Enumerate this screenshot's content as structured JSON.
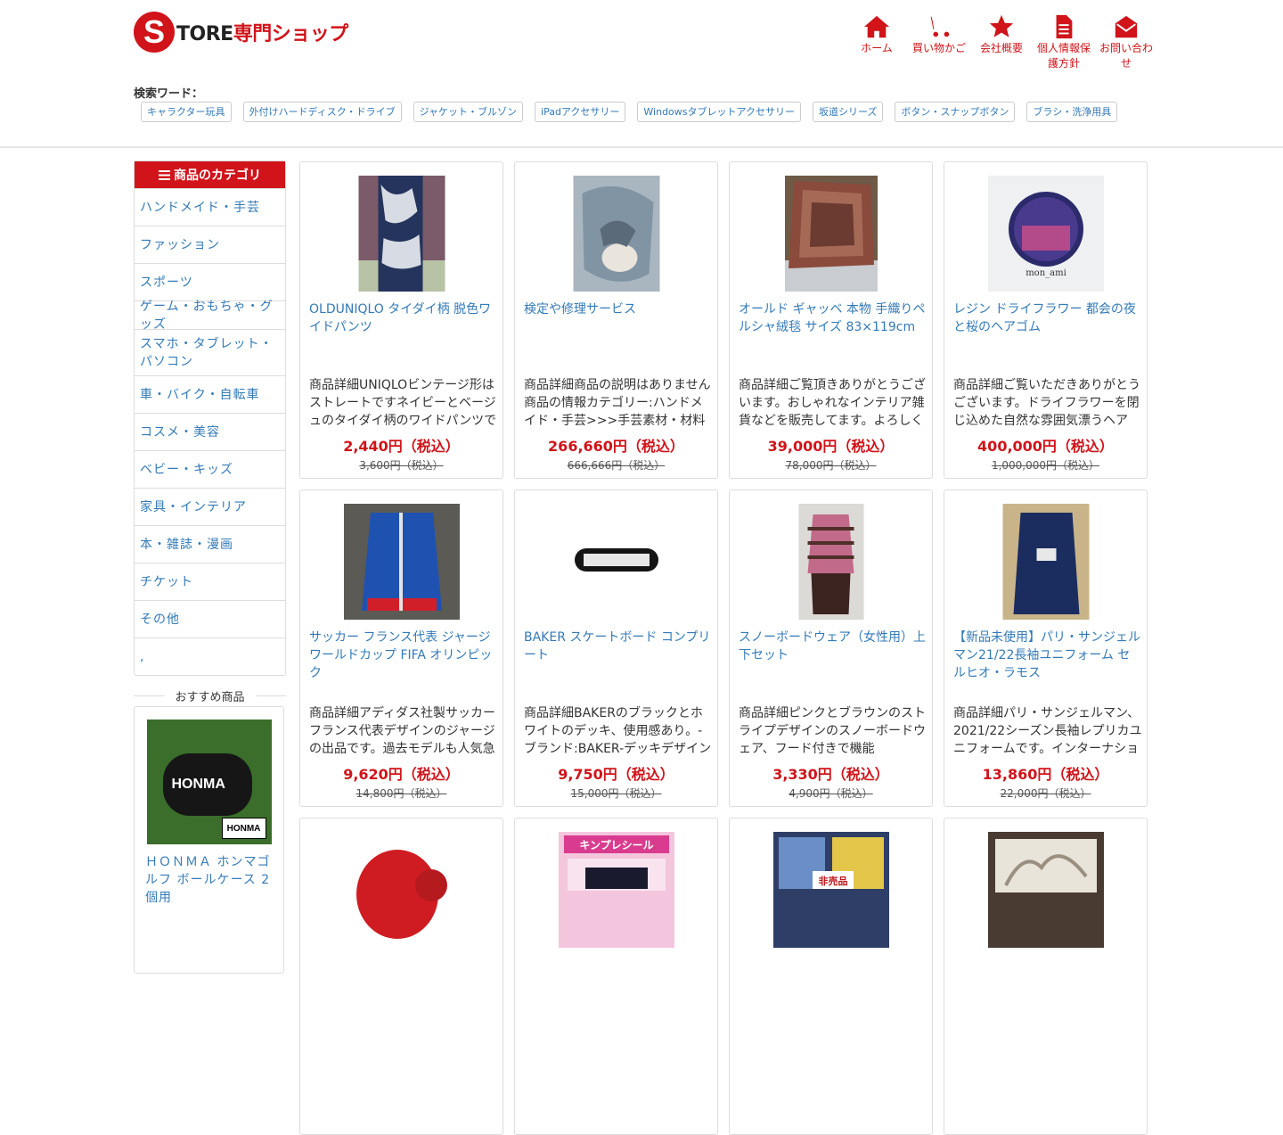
{
  "logo": {
    "letter": "S",
    "text_black": "TORE",
    "text_red": "専門ショップ"
  },
  "nav": [
    {
      "label": "ホーム",
      "icon": "home-icon"
    },
    {
      "label": "買い物かご",
      "icon": "cart-icon"
    },
    {
      "label": "会社概要",
      "icon": "star-icon"
    },
    {
      "label": "個人情報保護方針",
      "icon": "document-icon"
    },
    {
      "label": "お問い合わせ",
      "icon": "envelope-icon"
    }
  ],
  "search": {
    "label": "検索ワード：",
    "tags": [
      "キャラクター玩具",
      "外付けハードディスク・ドライブ",
      "ジャケット・ブルゾン",
      "iPadアクセサリー",
      "Windowsタブレットアクセサリー",
      "坂道シリーズ",
      "ボタン・スナップボタン",
      "ブラシ・洗浄用具"
    ]
  },
  "sidebar": {
    "title": "商品のカテゴリ",
    "categories": [
      "ハンドメイド・手芸",
      "ファッション",
      "スポーツ",
      "ゲーム・おもちゃ・グッズ",
      "スマホ・タブレット・パソコン",
      "車・バイク・自転車",
      "コスメ・美容",
      "ベビー・キッズ",
      "家具・インテリア",
      "本・雑誌・漫画",
      "チケット",
      "その他",
      ","
    ],
    "recommend_title": "おすすめ商品",
    "recommend": {
      "name": "ＨＯＮＭＡ ホンマゴルフ ボールケース 2個用",
      "image_brand": "HONMA",
      "image_badge": "HONMA"
    }
  },
  "products": [
    {
      "name": "OLDUNIQLO タイダイ柄 脱色ワイドパンツ",
      "desc": "商品詳細UNIQLOビンテージ形はストレートですネイビーとベージュのタイダイ柄のワイドパンツです",
      "price": "2,440円（税込）",
      "old": "3,600円（税込）"
    },
    {
      "name": "検定や修理サービス",
      "desc": "商品詳細商品の説明はありません商品の情報カテゴリー:ハンドメイド・手芸>>>手芸素材・材料",
      "price": "266,660円（税込）",
      "old": "666,666円（税込）"
    },
    {
      "name": "オールド ギャッベ 本物 手織りペルシャ絨毯 サイズ 83×119cm",
      "desc": "商品詳細ご覧頂きありがとうございます。おしゃれなインテリア雑貨などを販売してます。よろしく",
      "price": "39,000円（税込）",
      "old": "78,000円（税込）"
    },
    {
      "name": "レジン ドライフラワー 都会の夜と桜のヘアゴム",
      "desc": "商品詳細ご覧いただきありがとうございます。ドライフラワーを閉じ込めた自然な雰囲気漂うヘア",
      "price": "400,000円（税込）",
      "old": "1,000,000円（税込）"
    },
    {
      "name": "サッカー フランス代表 ジャージ ワールドカップ FIFA オリンピック",
      "desc": "商品詳細アディダス社製サッカーフランス代表デザインのジャージの出品です。過去モデルも人気急",
      "price": "9,620円（税込）",
      "old": "14,800円（税込）"
    },
    {
      "name": "BAKER スケートボード コンプリート",
      "desc": "商品詳細BAKERのブラックとホワイトのデッキ、使用感あり。-ブランド:BAKER-デッキデザイン",
      "price": "9,750円（税込）",
      "old": "15,000円（税込）"
    },
    {
      "name": "スノーボードウェア（女性用）上下セット",
      "desc": "商品詳細ピンクとブラウンのストライプデザインのスノーボードウェア、フード付きで機能",
      "price": "3,330円（税込）",
      "old": "4,900円（税込）"
    },
    {
      "name": "【新品未使用】パリ・サンジェルマン21/22長袖ユニフォーム セルヒオ・ラモス",
      "desc": "商品詳細パリ・サンジェルマン、2021/22シーズン長袖レプリカユニフォームです。インターナショナル",
      "price": "13,860円（税込）",
      "old": "22,000円（税込）"
    },
    {
      "name": "",
      "desc": "",
      "price": "",
      "old": ""
    },
    {
      "name": "",
      "desc": "",
      "price": "",
      "old": "",
      "image_text": "キンプレシール"
    },
    {
      "name": "",
      "desc": "",
      "price": "",
      "old": "",
      "image_text": "非売品"
    },
    {
      "name": "",
      "desc": "",
      "price": "",
      "old": ""
    }
  ]
}
